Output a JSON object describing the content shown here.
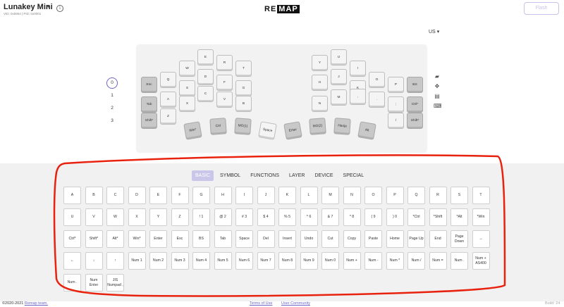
{
  "header": {
    "keyboard_name": "Lunakey Mini",
    "keyboard_ids": "VID: 0x5954 | PID: 0x0001",
    "logo_left": "RE",
    "logo_right": "MAP",
    "flash_label": "Flash"
  },
  "layout_select": {
    "value": "US"
  },
  "layers": [
    "0",
    "1",
    "2",
    "3"
  ],
  "keyboard_keys": [
    {
      "label": "",
      "dark": false
    },
    {
      "label": "Esc",
      "dark": true
    },
    {
      "label": "Q",
      "dark": false
    },
    {
      "label": "W",
      "dark": false
    },
    {
      "label": "E",
      "dark": false
    },
    {
      "label": "R",
      "dark": false
    },
    {
      "label": "T",
      "dark": false
    },
    {
      "label": "Y",
      "dark": false
    },
    {
      "label": "U",
      "dark": false
    },
    {
      "label": "I",
      "dark": false
    },
    {
      "label": "O",
      "dark": false
    },
    {
      "label": "P",
      "dark": false
    },
    {
      "label": "BS",
      "dark": true
    },
    {
      "label": "Tab",
      "dark": true
    },
    {
      "label": "A",
      "dark": false
    },
    {
      "label": "S",
      "dark": false
    },
    {
      "label": "D",
      "dark": false
    },
    {
      "label": "F",
      "dark": false
    },
    {
      "label": "G",
      "dark": false
    },
    {
      "label": "H",
      "dark": false
    },
    {
      "label": "J",
      "dark": false
    },
    {
      "label": "K",
      "dark": false
    },
    {
      "label": "L",
      "dark": false
    },
    {
      "label": ";",
      "dark": false
    },
    {
      "label": "Ctrl*",
      "dark": true
    },
    {
      "label": "Shift*",
      "dark": true
    },
    {
      "label": "Z",
      "dark": false
    },
    {
      "label": "X",
      "dark": false
    },
    {
      "label": "C",
      "dark": false
    },
    {
      "label": "V",
      "dark": false
    },
    {
      "label": "B",
      "dark": false
    },
    {
      "label": "N",
      "dark": false
    },
    {
      "label": "M",
      "dark": false
    },
    {
      "label": ",",
      "dark": false
    },
    {
      "label": ".",
      "dark": false
    },
    {
      "label": "/",
      "dark": false
    },
    {
      "label": "Shift*",
      "dark": true
    },
    {
      "label": "Win*",
      "dark": true
    },
    {
      "label": "Ctrl",
      "dark": true
    },
    {
      "label": "MO(1)",
      "dark": true
    },
    {
      "label": "Space",
      "dark": false
    },
    {
      "label": "Enter",
      "dark": true
    },
    {
      "label": "MO(2)",
      "dark": true
    },
    {
      "label": "Hanja",
      "dark": true
    },
    {
      "label": "Alt",
      "dark": true
    }
  ],
  "side_icons": [
    "keymap-icon",
    "cursor-icon",
    "file-icon",
    "keyboard-icon"
  ],
  "tabs": [
    "BASIC",
    "SYMBOL",
    "FUNCTIONS",
    "LAYER",
    "DEVICE",
    "SPECIAL"
  ],
  "palette_keys": [
    [
      "A",
      "B",
      "C",
      "D",
      "E",
      "F",
      "G",
      "H",
      "I",
      "J",
      "K",
      "L",
      "M",
      "N",
      "O",
      "P",
      "Q",
      "R",
      "S",
      "T"
    ],
    [
      "U",
      "V",
      "W",
      "X",
      "Y",
      "Z",
      "! 1",
      "@ 2",
      "# 3",
      "$ 4",
      "% 5",
      "^ 6",
      "& 7",
      "* 8",
      "( 9",
      ") 0",
      "*Ctrl",
      "*Shift",
      "*Alt",
      "*Win"
    ],
    [
      "Ctrl*",
      "Shift*",
      "Alt*",
      "Win*",
      "Enter",
      "Esc",
      "BS",
      "Tab",
      "Space",
      "Del",
      "Insert",
      "Undo",
      "Cut",
      "Copy",
      "Paste",
      "Home",
      "Page Up",
      "End",
      "Page Down",
      "→"
    ],
    [
      "←",
      "↓",
      "↑",
      "Num 1",
      "Num 2",
      "Num 3",
      "Num 4",
      "Num 5",
      "Num 6",
      "Num 7",
      "Num 8",
      "Num 9",
      "Num 0",
      "Num +",
      "Num -",
      "Num *",
      "Num /",
      "Num =",
      "Num .",
      "Num + AS400"
    ],
    [
      "Num .",
      "Num Enter",
      "JIS Numpad ,"
    ]
  ],
  "footer": {
    "copyright": "©2020-2021",
    "team_link": "Remap team.",
    "terms": "Terms of Use",
    "community": "User Community",
    "build": "Build: 24"
  },
  "colors": {
    "accent": "#6b66c7",
    "annotation": "#e8220e"
  }
}
